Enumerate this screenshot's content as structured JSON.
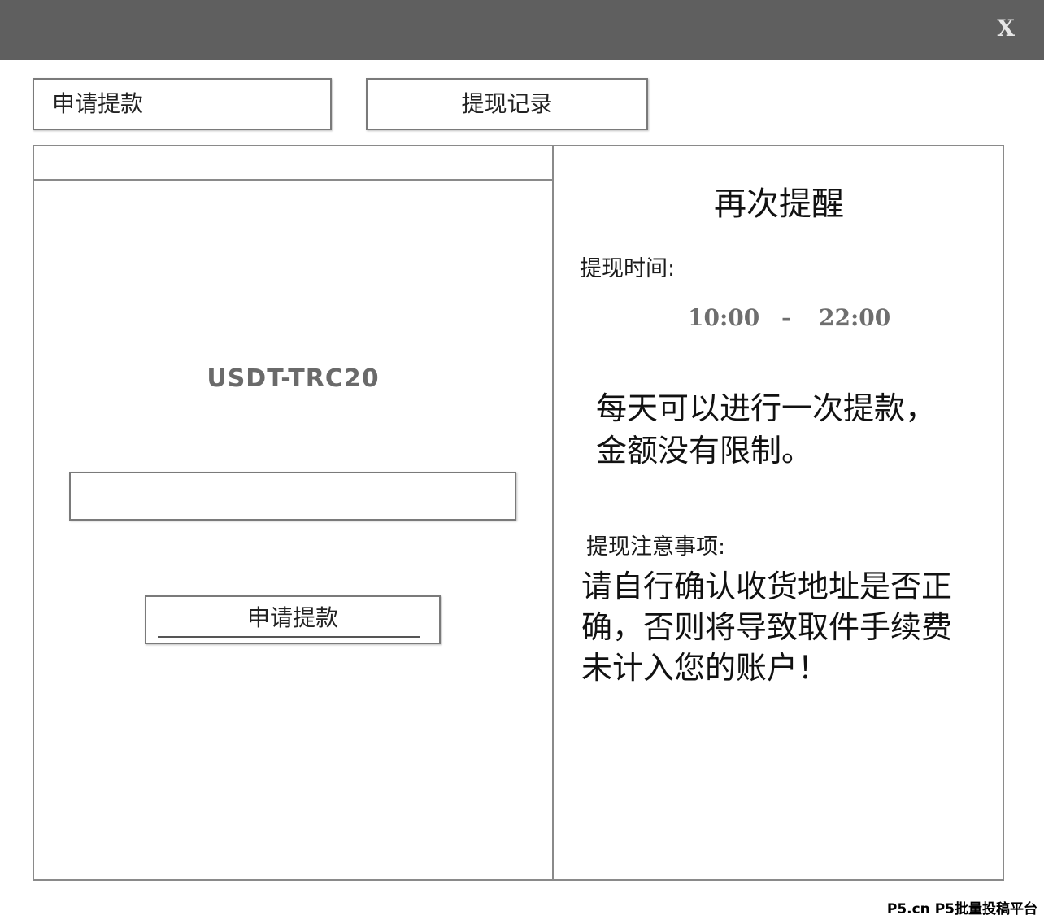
{
  "window": {
    "close_label": "X"
  },
  "tabs": {
    "apply_label": "申请提款",
    "record_label": "提现记录"
  },
  "withdraw_form": {
    "currency": "USDT-TRC20",
    "amount_value": "",
    "submit_label": "申请提款"
  },
  "reminder": {
    "title": "再次提醒",
    "time_label": "提现时间:",
    "time_start": "10:00",
    "time_separator": "-",
    "time_end": "22:00",
    "daily_note": "每天可以进行一次提款，金额没有限制。",
    "notice_label": "提现注意事项:",
    "notice_text": "请自行确认收货地址是否正确，否则将导致取件手续费未计入您的账户！"
  },
  "watermark": "P5.cn P5批量投稿平台"
}
